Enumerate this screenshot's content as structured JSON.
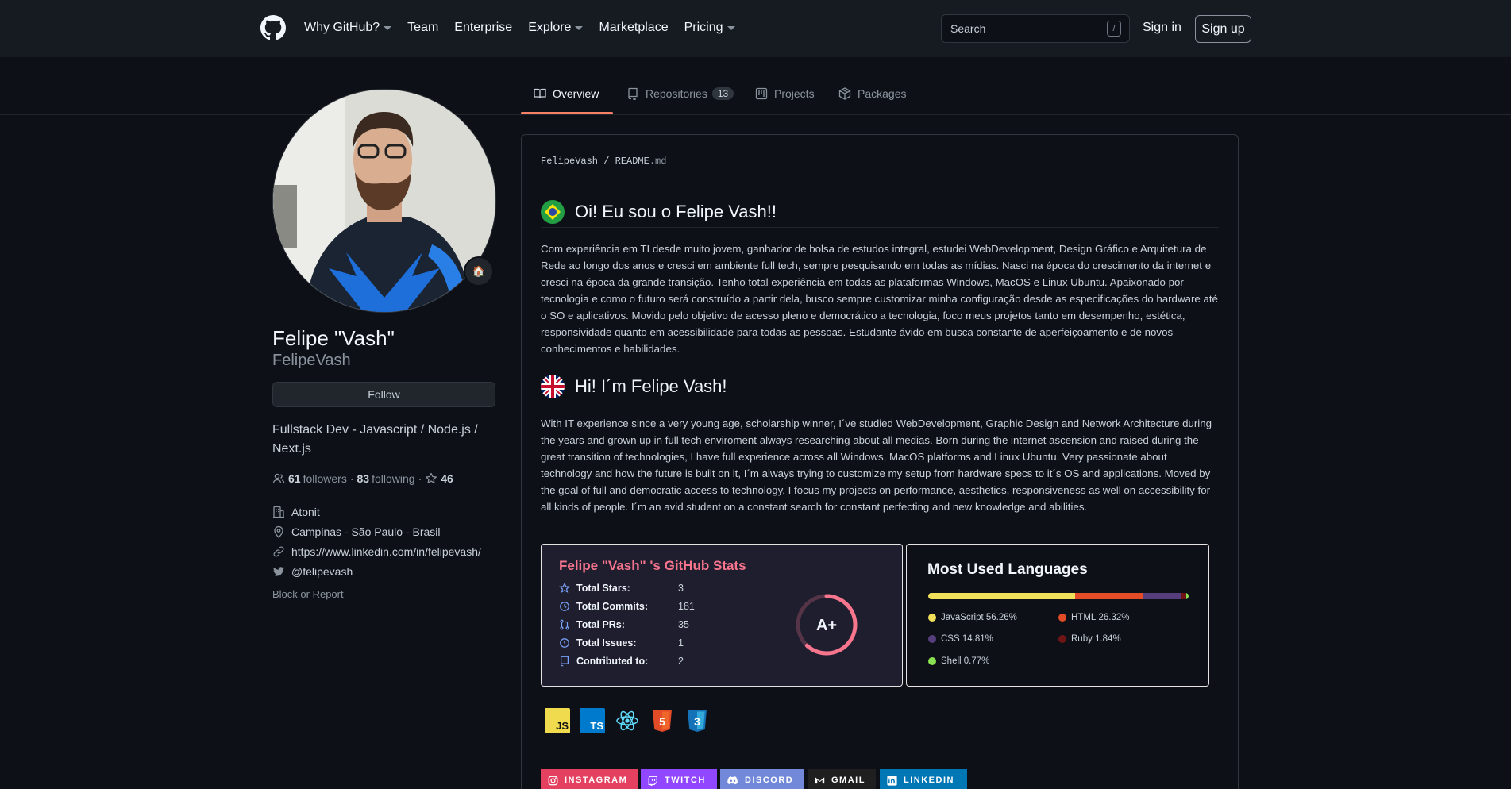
{
  "header": {
    "nav": [
      "Why GitHub?",
      "Team",
      "Enterprise",
      "Explore",
      "Marketplace",
      "Pricing"
    ],
    "search_placeholder": "Search",
    "search_shortcut": "/",
    "sign_in": "Sign in",
    "sign_up": "Sign up"
  },
  "tabs": {
    "overview": "Overview",
    "repositories": "Repositories",
    "repositories_count": "13",
    "projects": "Projects",
    "packages": "Packages"
  },
  "profile": {
    "full_name": "Felipe \"Vash\"",
    "username": "FelipeVash",
    "follow": "Follow",
    "bio": "Fullstack Dev - Javascript / Node.js / Next.js",
    "followers_count": "61",
    "followers_label": "followers",
    "following_count": "83",
    "following_label": "following",
    "stars": "46",
    "company": "Atonit",
    "location": "Campinas - São Paulo - Brasil",
    "website": "https://www.linkedin.com/in/felipevash/",
    "twitter": "@felipevash",
    "block": "Block or Report"
  },
  "readme": {
    "owner": "FelipeVash",
    "file": "README",
    "ext": ".md",
    "pt_title": "Oi! Eu sou o Felipe Vash!!",
    "pt_text": "Com experiência em TI desde muito jovem, ganhador de bolsa de estudos integral, estudei WebDevelopment, Design Gráfico e Arquitetura de Rede ao longo dos anos e cresci em ambiente full tech, sempre pesquisando em todas as mídias. Nasci na época do crescimento da internet e cresci na época da grande transição. Tenho total experiência em todas as plataformas Windows, MacOS e Linux Ubuntu. Apaixonado por tecnologia e como o futuro será construído a partir dela, busco sempre customizar minha configuração desde as especificações do hardware até o SO e aplicativos. Movido pelo objetivo de acesso pleno e democrático a tecnologia, foco meus projetos tanto em desempenho, estética, responsividade quanto em acessibilidade para todas as pessoas. Estudante ávido em busca constante de aperfeiçoamento e de novos conhecimentos e habilidades.",
    "en_title": "Hi! I´m Felipe Vash!",
    "en_text": "With IT experience since a very young age, scholarship winner, I´ve studied WebDevelopment, Graphic Design and Network Architecture during the years and grown up in full tech enviroment always researching about all medias. Born during the internet ascension and raised during the great transition of technologies, I have full experience across all Windows, MacOS platforms and Linux Ubuntu. Very passionate about technology and how the future is built on it, I´m always trying to customize my setup from hardware specs to it´s OS and applications. Moved by the goal of full and democratic access to technology, I focus my projects on performance, aesthetics, responsiveness as well on accessibility for all kinds of people. I´m an avid student on a constant search for constant perfecting and new knowledge and abilities."
  },
  "stats_card": {
    "title": "Felipe \"Vash\" 's GitHub Stats",
    "rows": [
      {
        "label": "Total Stars:",
        "value": "3"
      },
      {
        "label": "Total Commits:",
        "value": "181"
      },
      {
        "label": "Total PRs:",
        "value": "35"
      },
      {
        "label": "Total Issues:",
        "value": "1"
      },
      {
        "label": "Contributed to:",
        "value": "2"
      }
    ],
    "grade": "A+",
    "title_color": "#f7768e",
    "icon_color": "#7aa2f7"
  },
  "languages_card": {
    "title": "Most Used Languages",
    "items": [
      {
        "name": "JavaScript",
        "percent": "56.26%",
        "share": 56.26,
        "color": "#f1e05a"
      },
      {
        "name": "HTML",
        "percent": "26.32%",
        "share": 26.32,
        "color": "#e34c26"
      },
      {
        "name": "CSS",
        "percent": "14.81%",
        "share": 14.81,
        "color": "#563d7c"
      },
      {
        "name": "Ruby",
        "percent": "1.84%",
        "share": 1.84,
        "color": "#701516"
      },
      {
        "name": "Shell",
        "percent": "0.77%",
        "share": 0.77,
        "color": "#89e051"
      }
    ]
  },
  "tech_icons": [
    {
      "text": "JS",
      "icon": "javascript-icon"
    },
    {
      "text": "TS",
      "icon": "typescript-icon"
    },
    {
      "text": "",
      "icon": "react-icon"
    },
    {
      "text": "5",
      "icon": "html5-icon"
    },
    {
      "text": "3",
      "icon": "css3-icon"
    }
  ],
  "social_badges": [
    {
      "label": "INSTAGRAM",
      "color": "#e4405f"
    },
    {
      "label": "TWITCH",
      "color": "#9146ff"
    },
    {
      "label": "DISCORD",
      "color": "#7289da"
    },
    {
      "label": "GMAIL",
      "color": "#1f1f1f"
    },
    {
      "label": "LINKEDIN",
      "color": "#0077b5"
    }
  ]
}
